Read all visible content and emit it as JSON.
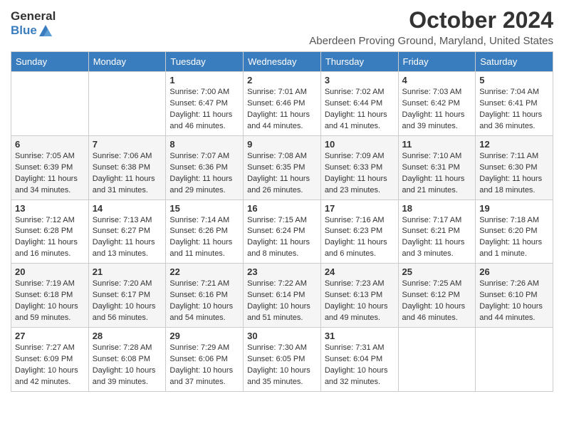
{
  "logo": {
    "general": "General",
    "blue": "Blue"
  },
  "title": "October 2024",
  "location": "Aberdeen Proving Ground, Maryland, United States",
  "days_of_week": [
    "Sunday",
    "Monday",
    "Tuesday",
    "Wednesday",
    "Thursday",
    "Friday",
    "Saturday"
  ],
  "weeks": [
    [
      {
        "day": "",
        "info": ""
      },
      {
        "day": "",
        "info": ""
      },
      {
        "day": "1",
        "info": "Sunrise: 7:00 AM\nSunset: 6:47 PM\nDaylight: 11 hours and 46 minutes."
      },
      {
        "day": "2",
        "info": "Sunrise: 7:01 AM\nSunset: 6:46 PM\nDaylight: 11 hours and 44 minutes."
      },
      {
        "day": "3",
        "info": "Sunrise: 7:02 AM\nSunset: 6:44 PM\nDaylight: 11 hours and 41 minutes."
      },
      {
        "day": "4",
        "info": "Sunrise: 7:03 AM\nSunset: 6:42 PM\nDaylight: 11 hours and 39 minutes."
      },
      {
        "day": "5",
        "info": "Sunrise: 7:04 AM\nSunset: 6:41 PM\nDaylight: 11 hours and 36 minutes."
      }
    ],
    [
      {
        "day": "6",
        "info": "Sunrise: 7:05 AM\nSunset: 6:39 PM\nDaylight: 11 hours and 34 minutes."
      },
      {
        "day": "7",
        "info": "Sunrise: 7:06 AM\nSunset: 6:38 PM\nDaylight: 11 hours and 31 minutes."
      },
      {
        "day": "8",
        "info": "Sunrise: 7:07 AM\nSunset: 6:36 PM\nDaylight: 11 hours and 29 minutes."
      },
      {
        "day": "9",
        "info": "Sunrise: 7:08 AM\nSunset: 6:35 PM\nDaylight: 11 hours and 26 minutes."
      },
      {
        "day": "10",
        "info": "Sunrise: 7:09 AM\nSunset: 6:33 PM\nDaylight: 11 hours and 23 minutes."
      },
      {
        "day": "11",
        "info": "Sunrise: 7:10 AM\nSunset: 6:31 PM\nDaylight: 11 hours and 21 minutes."
      },
      {
        "day": "12",
        "info": "Sunrise: 7:11 AM\nSunset: 6:30 PM\nDaylight: 11 hours and 18 minutes."
      }
    ],
    [
      {
        "day": "13",
        "info": "Sunrise: 7:12 AM\nSunset: 6:28 PM\nDaylight: 11 hours and 16 minutes."
      },
      {
        "day": "14",
        "info": "Sunrise: 7:13 AM\nSunset: 6:27 PM\nDaylight: 11 hours and 13 minutes."
      },
      {
        "day": "15",
        "info": "Sunrise: 7:14 AM\nSunset: 6:26 PM\nDaylight: 11 hours and 11 minutes."
      },
      {
        "day": "16",
        "info": "Sunrise: 7:15 AM\nSunset: 6:24 PM\nDaylight: 11 hours and 8 minutes."
      },
      {
        "day": "17",
        "info": "Sunrise: 7:16 AM\nSunset: 6:23 PM\nDaylight: 11 hours and 6 minutes."
      },
      {
        "day": "18",
        "info": "Sunrise: 7:17 AM\nSunset: 6:21 PM\nDaylight: 11 hours and 3 minutes."
      },
      {
        "day": "19",
        "info": "Sunrise: 7:18 AM\nSunset: 6:20 PM\nDaylight: 11 hours and 1 minute."
      }
    ],
    [
      {
        "day": "20",
        "info": "Sunrise: 7:19 AM\nSunset: 6:18 PM\nDaylight: 10 hours and 59 minutes."
      },
      {
        "day": "21",
        "info": "Sunrise: 7:20 AM\nSunset: 6:17 PM\nDaylight: 10 hours and 56 minutes."
      },
      {
        "day": "22",
        "info": "Sunrise: 7:21 AM\nSunset: 6:16 PM\nDaylight: 10 hours and 54 minutes."
      },
      {
        "day": "23",
        "info": "Sunrise: 7:22 AM\nSunset: 6:14 PM\nDaylight: 10 hours and 51 minutes."
      },
      {
        "day": "24",
        "info": "Sunrise: 7:23 AM\nSunset: 6:13 PM\nDaylight: 10 hours and 49 minutes."
      },
      {
        "day": "25",
        "info": "Sunrise: 7:25 AM\nSunset: 6:12 PM\nDaylight: 10 hours and 46 minutes."
      },
      {
        "day": "26",
        "info": "Sunrise: 7:26 AM\nSunset: 6:10 PM\nDaylight: 10 hours and 44 minutes."
      }
    ],
    [
      {
        "day": "27",
        "info": "Sunrise: 7:27 AM\nSunset: 6:09 PM\nDaylight: 10 hours and 42 minutes."
      },
      {
        "day": "28",
        "info": "Sunrise: 7:28 AM\nSunset: 6:08 PM\nDaylight: 10 hours and 39 minutes."
      },
      {
        "day": "29",
        "info": "Sunrise: 7:29 AM\nSunset: 6:06 PM\nDaylight: 10 hours and 37 minutes."
      },
      {
        "day": "30",
        "info": "Sunrise: 7:30 AM\nSunset: 6:05 PM\nDaylight: 10 hours and 35 minutes."
      },
      {
        "day": "31",
        "info": "Sunrise: 7:31 AM\nSunset: 6:04 PM\nDaylight: 10 hours and 32 minutes."
      },
      {
        "day": "",
        "info": ""
      },
      {
        "day": "",
        "info": ""
      }
    ]
  ]
}
